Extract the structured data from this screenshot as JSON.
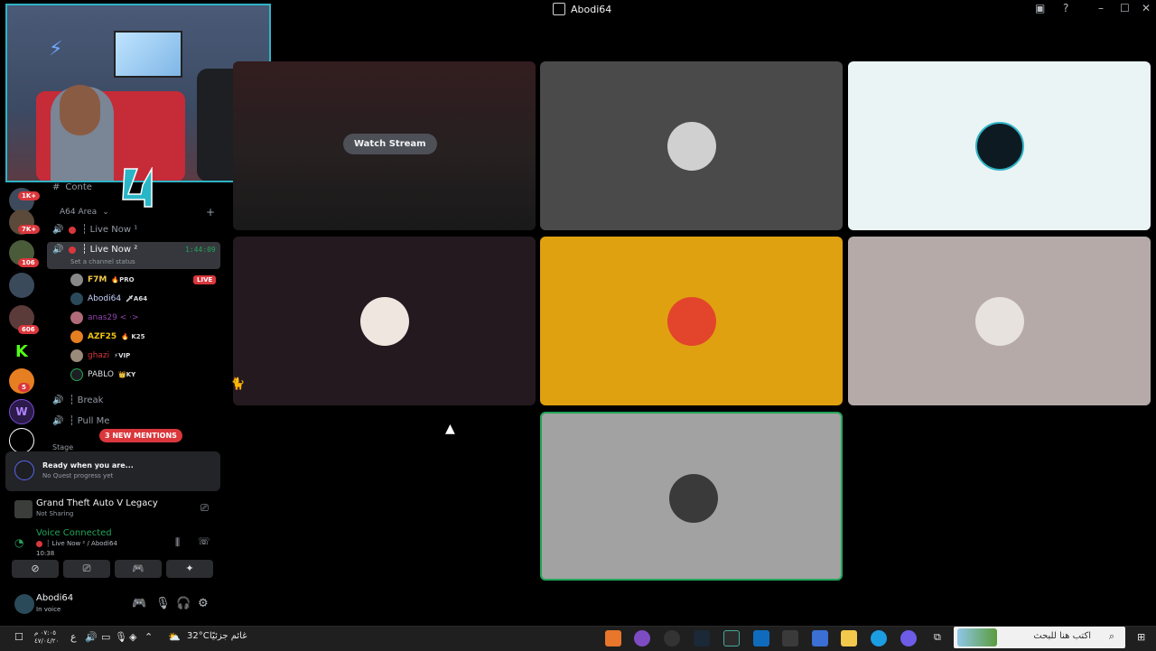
{
  "window": {
    "title": "Abodi64"
  },
  "webcam": {
    "neon_glyph": "⚡"
  },
  "server_rail": {
    "badges": [
      "1K+",
      "7K+",
      "106",
      "606",
      "5"
    ]
  },
  "channels": {
    "truncated_top": "Conte",
    "category": "A64 Area",
    "items": [
      {
        "name": "┆ Live Now ¹"
      },
      {
        "name": "┆ Live Now ²",
        "timer": "1:44:09",
        "status_placeholder": "Set a channel status"
      },
      {
        "name": "┆ Break"
      },
      {
        "name": "┆ Pull Me"
      }
    ],
    "truncated_bottom": "Stage",
    "members": [
      {
        "name": "F7M",
        "tag": "🔥PRO",
        "color": "#f2c94c",
        "live": "LIVE"
      },
      {
        "name": "Abodi64",
        "tag": "🗡A64",
        "color": "#5865f2"
      },
      {
        "name": "anas29 < ·>",
        "tag": "",
        "color": "#8e44ad"
      },
      {
        "name": "AZF25",
        "tag": "🔥 K25",
        "color": "#f1c40f"
      },
      {
        "name": "ghazi",
        "tag": "⚡VIP",
        "color": "#da373c"
      },
      {
        "name": "PABLO",
        "tag": "👑KY",
        "color": "#dbdee1"
      }
    ],
    "mentions_pill": "3 NEW MENTIONS"
  },
  "quest": {
    "title": "Ready when you are...",
    "subtitle": "No Quest progress yet"
  },
  "activity": {
    "game": "Grand Theft Auto V Legacy",
    "status": "Not Sharing"
  },
  "voice": {
    "status": "Voice Connected",
    "channel": "┆ Live Now ² / Abodi64",
    "time": "10:38"
  },
  "user": {
    "name": "Abodi64",
    "status": "In voice"
  },
  "stage": {
    "watch_stream_label": "Watch Stream",
    "tiles": [
      {
        "bg": "#4a4a4a"
      },
      {
        "bg": "#eaf4f4"
      },
      {
        "bg": "#24191f"
      },
      {
        "bg": "#e0a110"
      },
      {
        "bg": "#b5aaa8"
      },
      {
        "bg": "#a2a2a2"
      }
    ]
  },
  "taskbar": {
    "search_placeholder": "اكتب هنا للبحث",
    "weather": "32°C",
    "weather_note": "غائم جزئيًا",
    "clock_time": "٠٧:٠٥ م",
    "clock_date": "٤٧/٠٤/٢٠",
    "lang": "ع"
  },
  "colors": {
    "accent": "#5865f2",
    "live": "#da373c",
    "connected": "#23a55a",
    "speaking": "#23a55a"
  }
}
